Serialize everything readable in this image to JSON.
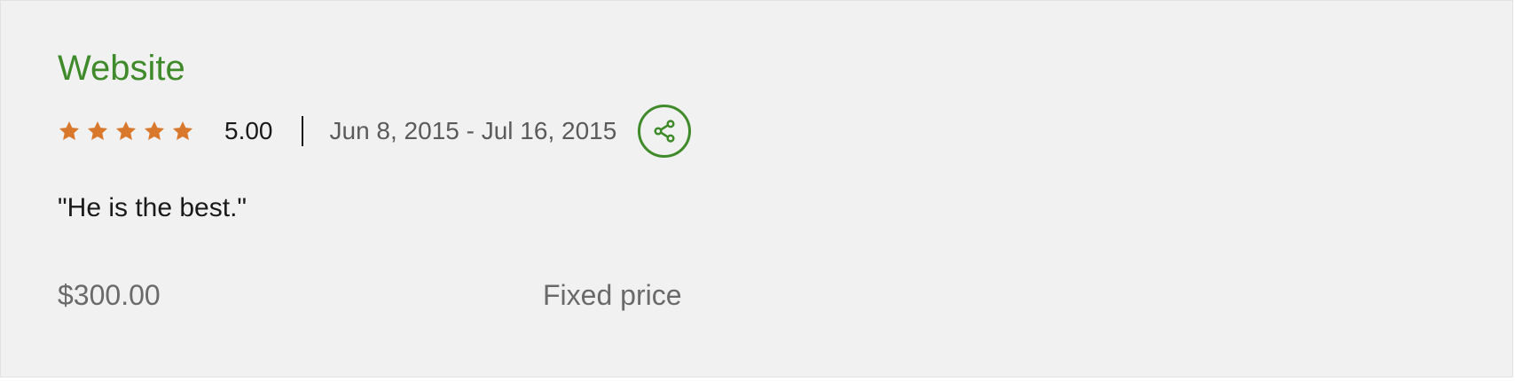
{
  "review": {
    "title": "Website",
    "rating": "5.00",
    "rating_value": 5,
    "rating_max": 5,
    "date_range": "Jun 8, 2015 - Jul 16, 2015",
    "quote": "\"He is the best.\"",
    "price": "$300.00",
    "price_type": "Fixed price"
  },
  "colors": {
    "accent": "#3f8a2a",
    "star": "#d9772a",
    "background": "#f1f1f1"
  },
  "icons": {
    "star": "star-icon",
    "share": "share-icon"
  }
}
